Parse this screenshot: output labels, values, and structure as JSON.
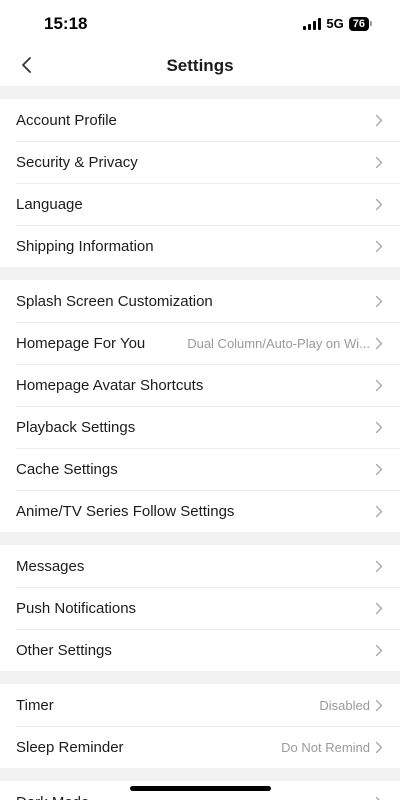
{
  "status_bar": {
    "time": "15:18",
    "network": "5G",
    "battery": "76"
  },
  "header": {
    "title": "Settings"
  },
  "groups": [
    {
      "items": [
        {
          "label": "Account Profile",
          "value": ""
        },
        {
          "label": "Security & Privacy",
          "value": ""
        },
        {
          "label": "Language",
          "value": ""
        },
        {
          "label": "Shipping Information",
          "value": ""
        }
      ]
    },
    {
      "items": [
        {
          "label": "Splash Screen Customization",
          "value": ""
        },
        {
          "label": "Homepage For You",
          "value": "Dual Column/Auto-Play on Wi..."
        },
        {
          "label": "Homepage Avatar Shortcuts",
          "value": ""
        },
        {
          "label": "Playback Settings",
          "value": ""
        },
        {
          "label": "Cache Settings",
          "value": ""
        },
        {
          "label": "Anime/TV Series Follow Settings",
          "value": ""
        }
      ]
    },
    {
      "items": [
        {
          "label": "Messages",
          "value": ""
        },
        {
          "label": "Push Notifications",
          "value": ""
        },
        {
          "label": "Other Settings",
          "value": ""
        }
      ]
    },
    {
      "items": [
        {
          "label": "Timer",
          "value": "Disabled"
        },
        {
          "label": "Sleep Reminder",
          "value": "Do Not Remind"
        }
      ]
    },
    {
      "items": [
        {
          "label": "Dark Mode",
          "value": ""
        }
      ]
    }
  ],
  "icons": {
    "back": "chevron-left-icon",
    "row_arrow": "chevron-right-icon"
  },
  "colors": {
    "background": "#f2f2f2",
    "row_background": "#ffffff",
    "value_text": "#9a9a9a"
  }
}
